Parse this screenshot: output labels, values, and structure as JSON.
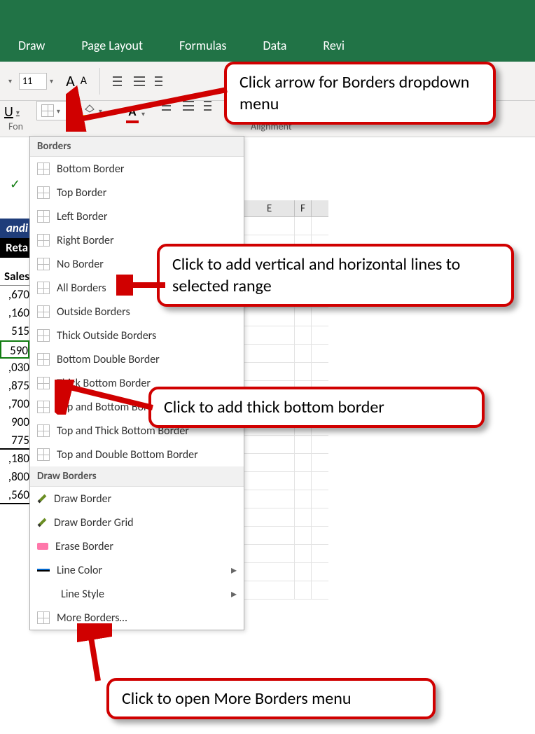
{
  "ribbon": {
    "tabs": [
      "Draw",
      "Page Layout",
      "Formulas",
      "Data",
      "Revi"
    ]
  },
  "toolbar": {
    "font_size": "11",
    "incr_label": "A",
    "decr_label": "A"
  },
  "format_row": {
    "underline_label": "U"
  },
  "group_labels": {
    "font": "Fon",
    "alignment": "Alignment"
  },
  "column_headers": [
    "E",
    "F"
  ],
  "partial_cells": {
    "andi": "andi",
    "retai": "Reta",
    "sales": "Sales"
  },
  "values": [
    ",670",
    ",160",
    "515",
    "590",
    ",030",
    ",875",
    ",700",
    "900",
    "775",
    ",180",
    ",800",
    ",560"
  ],
  "dropdown": {
    "section1": "Borders",
    "items1": [
      "Bottom Border",
      "Top Border",
      "Left Border",
      "Right Border",
      "No Border",
      "All Borders",
      "Outside Borders",
      "Thick Outside Borders",
      "Bottom Double Border",
      "Thick Bottom Border",
      "Top and Bottom Border",
      "Top and Thick Bottom Border",
      "Top and Double Bottom Border"
    ],
    "section2": "Draw Borders",
    "items2": [
      "Draw Border",
      "Draw Border Grid",
      "Erase Border",
      "Line Color",
      "Line Style",
      "More Borders…"
    ]
  },
  "callouts": {
    "c1": "Click arrow for Borders dropdown menu",
    "c2": "Click to add vertical and horizontal lines to selected range",
    "c3": "Click to add thick bottom border",
    "c4": "Click to open More Borders menu"
  }
}
